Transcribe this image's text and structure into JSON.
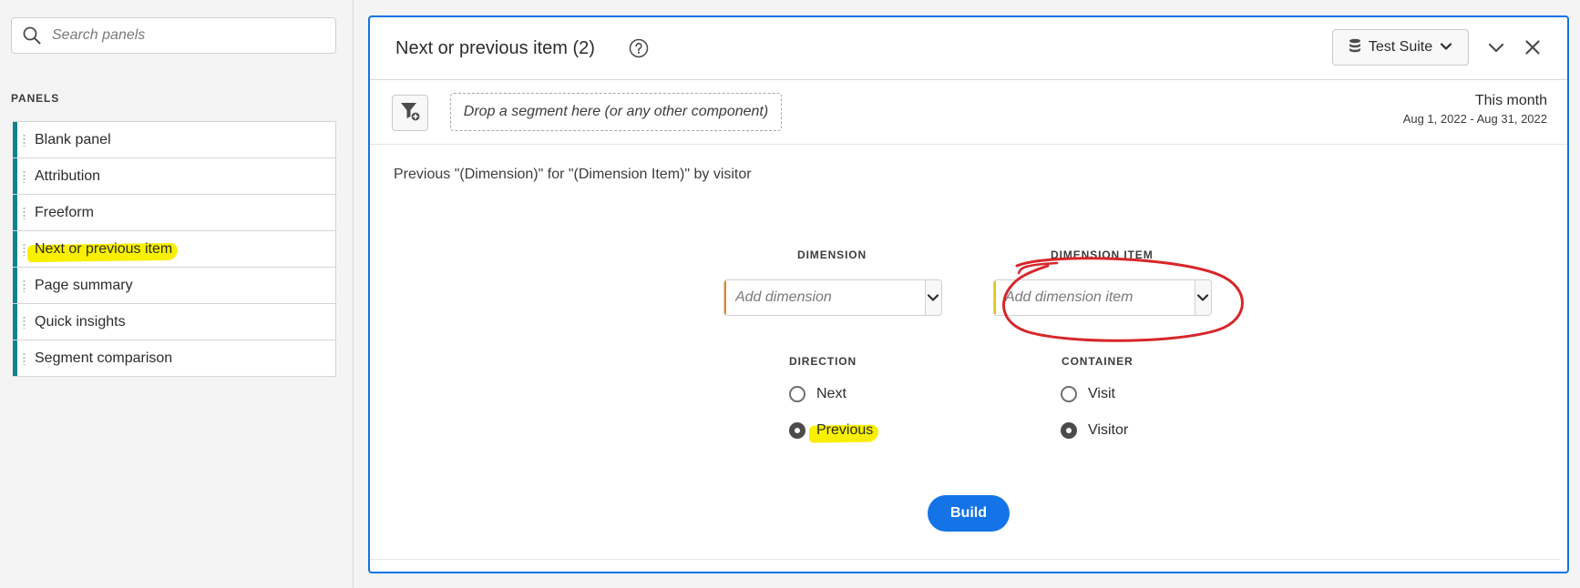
{
  "sidebar": {
    "search_placeholder": "Search panels",
    "section_title": "PANELS",
    "items": [
      {
        "label": "Blank panel"
      },
      {
        "label": "Attribution"
      },
      {
        "label": "Freeform"
      },
      {
        "label": "Next or previous item",
        "highlighted": true
      },
      {
        "label": "Page summary"
      },
      {
        "label": "Quick insights"
      },
      {
        "label": "Segment comparison"
      }
    ],
    "item_accent_color": "#12838a"
  },
  "panel": {
    "title": "Next or previous item (2)",
    "suite_label": "Test Suite",
    "segment_drop_text": "Drop a segment here (or any other component)",
    "date_label": "This month",
    "date_range": "Aug 1, 2022 - Aug 31, 2022",
    "description": "Previous \"(Dimension)\" for \"(Dimension Item)\" by visitor",
    "dimension": {
      "label": "DIMENSION",
      "placeholder": "Add dimension",
      "accent_color": "#e68619"
    },
    "dimension_item": {
      "label": "DIMENSION ITEM",
      "placeholder": "Add dimension item",
      "accent_color": "#e8c600"
    },
    "direction": {
      "label": "DIRECTION",
      "options": [
        "Next",
        "Previous"
      ],
      "selected": "Previous"
    },
    "container": {
      "label": "CONTAINER",
      "options": [
        "Visit",
        "Visitor"
      ],
      "selected": "Visitor"
    },
    "build_label": "Build",
    "border_color": "#1473e6"
  },
  "annotations": {
    "highlight_color": "#f8f000",
    "circle_color": "#d7262b"
  }
}
